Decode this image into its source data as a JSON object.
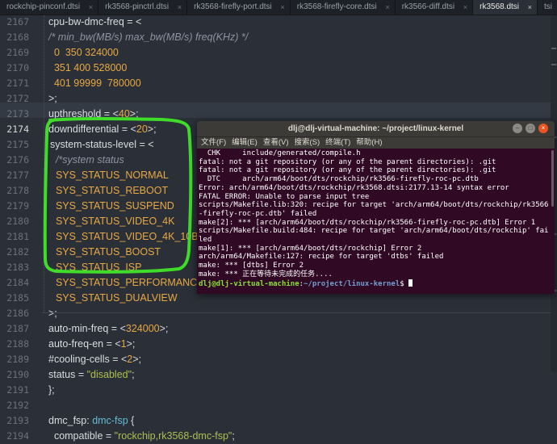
{
  "tabs": [
    {
      "label": "rockchip-pinconf.dtsi",
      "active": false
    },
    {
      "label": "rk3568-pinctrl.dtsi",
      "active": false
    },
    {
      "label": "rk3568-firefly-port.dtsi",
      "active": false
    },
    {
      "label": "rk3568-firefly-core.dtsi",
      "active": false
    },
    {
      "label": "rk3566-diff.dtsi",
      "active": false
    },
    {
      "label": "rk3568.dtsi",
      "active": true
    },
    {
      "label": "tsi",
      "active": false
    }
  ],
  "close_glyph": "×",
  "editor": {
    "current_line": "2174",
    "lines": [
      {
        "n": "2167",
        "parts": [
          [
            "kw",
            "cpu-bw-dmc-freq = <"
          ]
        ]
      },
      {
        "n": "2168",
        "parts": [
          [
            "cmt",
            "/* min_bw(MB/s) max_bw(MB/s) freq(KHz) */"
          ]
        ]
      },
      {
        "n": "2169",
        "parts": [
          [
            "num",
            "  0  350 324000"
          ]
        ]
      },
      {
        "n": "2170",
        "parts": [
          [
            "num",
            "  351 400 528000"
          ]
        ]
      },
      {
        "n": "2171",
        "parts": [
          [
            "num",
            "  401 99999  780000"
          ]
        ]
      },
      {
        "n": "2172",
        "parts": [
          [
            "kw",
            ">;"
          ]
        ]
      },
      {
        "n": "2173",
        "parts": [
          [
            "kw",
            "upthreshold = <"
          ],
          [
            "num",
            "40"
          ],
          [
            "kw",
            ">;"
          ]
        ]
      },
      {
        "n": "2174",
        "parts": [
          [
            "kw",
            "downdifferential = <"
          ],
          [
            "num",
            "20"
          ],
          [
            "kw",
            ">;"
          ]
        ]
      },
      {
        "n": "2175",
        "parts": [
          [
            "kw",
            "system-status-level = <"
          ]
        ]
      },
      {
        "n": "2176",
        "parts": [
          [
            "cmt",
            "  /*system status"
          ]
        ]
      },
      {
        "n": "2177",
        "parts": [
          [
            "num",
            "  SYS_STATUS_NORMAL"
          ]
        ]
      },
      {
        "n": "2178",
        "parts": [
          [
            "num",
            "  SYS_STATUS_REBOOT"
          ]
        ]
      },
      {
        "n": "2179",
        "parts": [
          [
            "num",
            "  SYS_STATUS_SUSPEND"
          ]
        ]
      },
      {
        "n": "2180",
        "parts": [
          [
            "num",
            "  SYS_STATUS_VIDEO_4K"
          ]
        ]
      },
      {
        "n": "2181",
        "parts": [
          [
            "num",
            "  SYS_STATUS_VIDEO_4K_10B"
          ]
        ]
      },
      {
        "n": "2182",
        "parts": [
          [
            "num",
            "  SYS_STATUS_BOOST"
          ]
        ]
      },
      {
        "n": "2183",
        "parts": [
          [
            "num",
            "  SYS_STATUS_ISP"
          ]
        ]
      },
      {
        "n": "2184",
        "parts": [
          [
            "num",
            "  SYS_STATUS_PERFORMANCE"
          ]
        ]
      },
      {
        "n": "2185",
        "parts": [
          [
            "num",
            "  SYS_STATUS_DUALVIEW"
          ]
        ]
      },
      {
        "n": "2186",
        "parts": [
          [
            "kw",
            ">;"
          ]
        ]
      },
      {
        "n": "2187",
        "parts": [
          [
            "kw",
            "auto-min-freq = <"
          ],
          [
            "num",
            "324000"
          ],
          [
            "kw",
            ">;"
          ]
        ]
      },
      {
        "n": "2188",
        "parts": [
          [
            "kw",
            "auto-freq-en = <"
          ],
          [
            "num",
            "1"
          ],
          [
            "kw",
            ">;"
          ]
        ]
      },
      {
        "n": "2189",
        "parts": [
          [
            "kw",
            "#cooling-cells = <"
          ],
          [
            "num",
            "2"
          ],
          [
            "kw",
            ">;"
          ]
        ]
      },
      {
        "n": "2190",
        "parts": [
          [
            "kw",
            "status = "
          ],
          [
            "str",
            "\"disabled\""
          ],
          [
            "kw",
            ";"
          ]
        ]
      },
      {
        "n": "2191",
        "parts": [
          [
            "kw",
            "};"
          ]
        ]
      },
      {
        "n": "2192",
        "parts": []
      },
      {
        "n": "2193",
        "parts": [
          [
            "kw",
            "dmc_fsp: "
          ],
          [
            "fn",
            "dmc-fsp"
          ],
          [
            "kw",
            " {"
          ]
        ]
      },
      {
        "n": "2194",
        "parts": [
          [
            "kw",
            "  compatible = "
          ],
          [
            "str",
            "\"rockchip,rk3568-dmc-fsp\""
          ],
          [
            "kw",
            ";"
          ]
        ]
      }
    ]
  },
  "terminal": {
    "title": "dlj@dlj-virtual-machine: ~/project/linux-kernel",
    "menu": [
      "文件(F)",
      "编辑(E)",
      "查看(V)",
      "搜索(S)",
      "终端(T)",
      "帮助(H)"
    ],
    "buttons": {
      "minimize": "–",
      "maximize": "□",
      "close": "×"
    },
    "lines": [
      "  CHK     include/generated/compile.h",
      "fatal: not a git repository (or any of the parent directories): .git",
      "fatal: not a git repository (or any of the parent directories): .git",
      "  DTC     arch/arm64/boot/dts/rockchip/rk3566-firefly-roc-pc.dtb",
      "Error: arch/arm64/boot/dts/rockchip/rk3568.dtsi:2177.13-14 syntax error",
      "FATAL ERROR: Unable to parse input tree",
      "scripts/Makefile.lib:320: recipe for target 'arch/arm64/boot/dts/rockchip/rk3566",
      "-firefly-roc-pc.dtb' failed",
      "make[2]: *** [arch/arm64/boot/dts/rockchip/rk3566-firefly-roc-pc.dtb] Error 1",
      "scripts/Makefile.build:484: recipe for target 'arch/arm64/boot/dts/rockchip' fai",
      "led",
      "make[1]: *** [arch/arm64/boot/dts/rockchip] Error 2",
      "arch/arm64/Makefile:127: recipe for target 'dtbs' failed",
      "make: *** [dtbs] Error 2",
      "make: *** 正在等待未完成的任务...."
    ],
    "prompt_user": "dlj@dlj-virtual-machine",
    "prompt_sep": ":",
    "prompt_path": "~/project/linux-kernel",
    "prompt_end": "$ "
  },
  "colors": {
    "editor_bg": "#2b3038",
    "number": "#e8a843",
    "comment": "#8e93a3",
    "string": "#aebf4f",
    "terminal_bg": "#300a24",
    "annotation": "#3fdc2a"
  }
}
